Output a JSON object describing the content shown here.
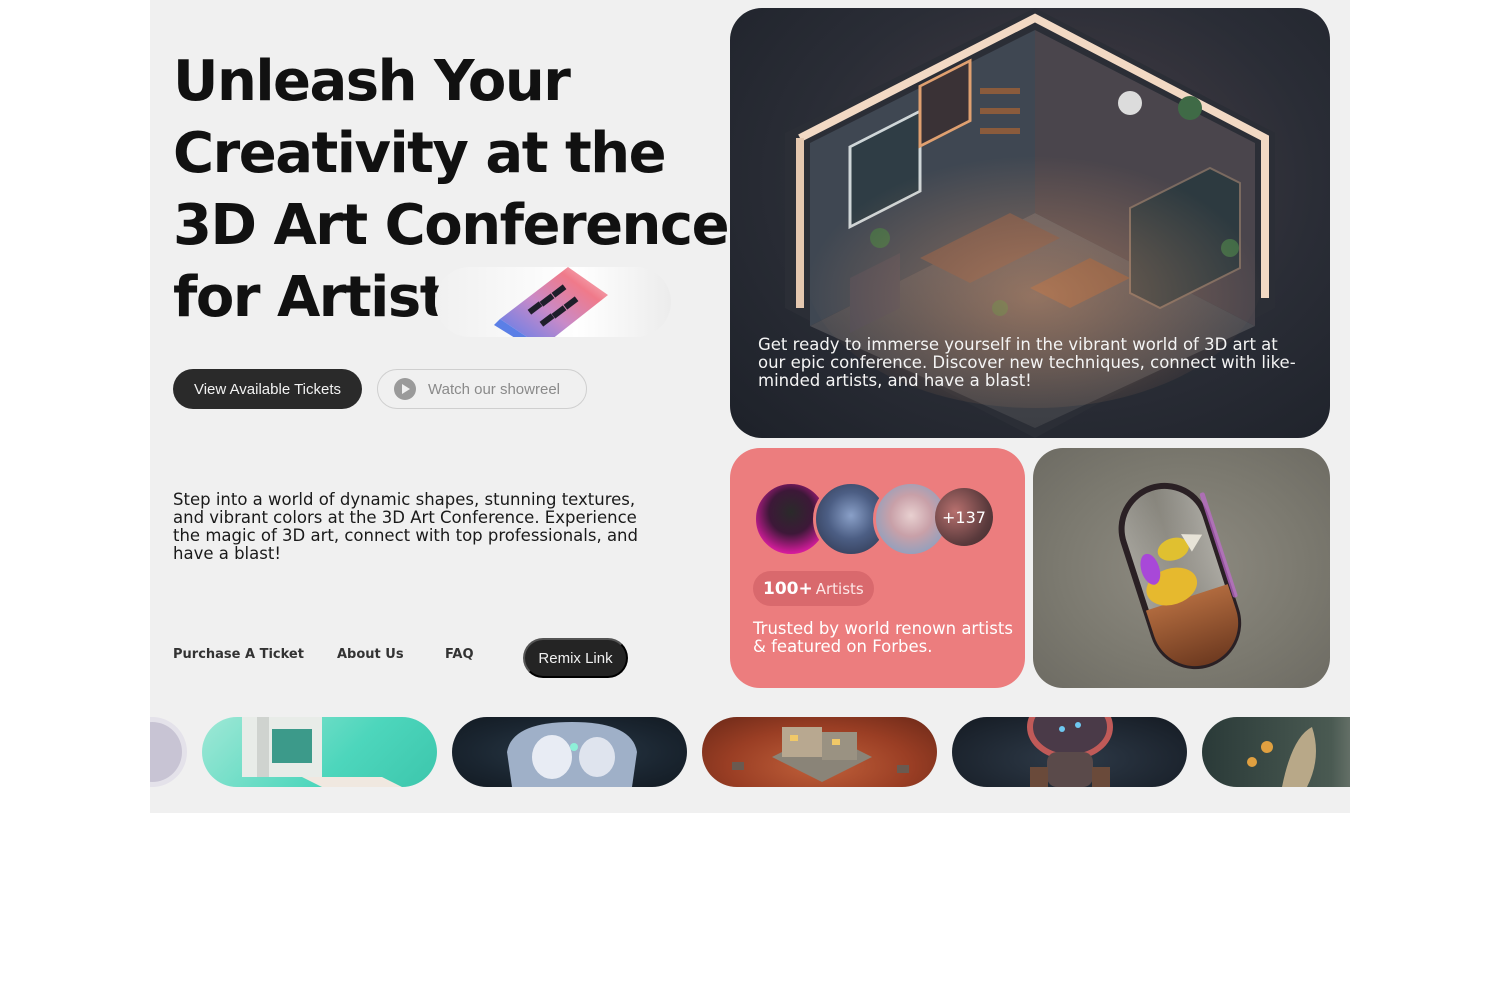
{
  "hero": {
    "headline_lines": [
      "Unleash Your",
      "Creativity at the",
      "3D Art Conference",
      "for Artists"
    ],
    "primary_button": "View Available Tickets",
    "secondary_button": "Watch our showreel",
    "intro_text": "Step into a world of dynamic shapes, stunning textures, and vibrant colors at the 3D Art Conference. Experience the magic of 3D art, connect with top professionals, and have a blast!"
  },
  "nav": {
    "links": [
      "Purchase A Ticket",
      "About Us",
      "FAQ"
    ],
    "cta": "Remix Link"
  },
  "feature_card": {
    "caption": "Get ready to immerse yourself in the vibrant world of 3D art at our epic conference. Discover new techniques, connect with like-minded artists, and have a blast!"
  },
  "artists_card": {
    "more_count": "+137",
    "badge_number": "100+",
    "badge_label": "Artists",
    "text": "Trusted by world renown artists & featured on Forbes."
  },
  "colors": {
    "page_bg": "#f0f0f0",
    "dark_button": "#2a2a2a",
    "artists_card": "#ec7d7e",
    "badge": "#d9696d"
  },
  "icons": {
    "play": "play-icon"
  }
}
